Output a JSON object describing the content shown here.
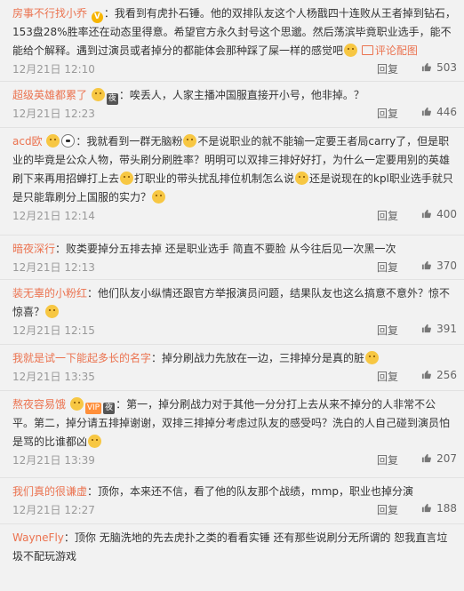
{
  "comments": [
    {
      "user": "房事不行找小乔",
      "badge": "V",
      "text_parts": [
        "：我看到有虎扑石锤。他的双排队友这个人杨戬四十连败从王者掉到钻石，153盘28%胜率还在动态里得意。希望官方永久封号这个思邈。然后荡滨毕竟职业选手，能不能给个解释。遇到过演员或者掉分的都能体会那种踩了屎一样的感觉吧"
      ],
      "pic_link": "评论配图",
      "time": "12月21日 12:10",
      "reply": "回复",
      "likes": "503"
    },
    {
      "user": "超级英雄都累了",
      "text_parts": [
        "：唉丢人，人家主播冲国服直接开小号，他非掉。？"
      ],
      "time": "12月21日 12:23",
      "reply": "回复",
      "likes": "446"
    },
    {
      "user": "acd欧",
      "text_parts": [
        "：我就看到一群无脑粉",
        "不是说职业的就不能输一定要王者局carry了，但是职业的毕竟是公众人物，带头刷分刷胜率？明明可以双排三排好好打，为什么一定要用别的英雄刷下来再用招蝉打上去",
        "打职业的带头扰乱排位机制怎么说",
        "还是说现在的kpl职业选手就只是只能靠刷分上国服的实力？"
      ],
      "time": "12月21日 12:14",
      "reply": "回复",
      "likes": "400"
    },
    {
      "user": "暗夜深行",
      "text_parts": [
        "：败类要掉分五排去掉 还是职业选手 简直不要脸 从今往后见一次黑一次"
      ],
      "time": "12月21日 12:13",
      "reply": "回复",
      "likes": "370"
    },
    {
      "user": "装无辜的小粉红",
      "text_parts": [
        "：他们队友小纵情还跟官方举报演员问题，结果队友也这么搞意不意外？惊不惊喜？"
      ],
      "time": "12月21日 12:15",
      "reply": "回复",
      "likes": "391"
    },
    {
      "user": "我就是试一下能起多长的名字",
      "text_parts": [
        "：掉分刷战力先放在一边，三排掉分是真的脏"
      ],
      "time": "12月21日 13:35",
      "reply": "回复",
      "likes": "256"
    },
    {
      "user": "熬夜容易饿",
      "text_parts": [
        "：第一，掉分刷战力对于其他一分分打上去从来不掉分的人非常不公平。第二，掉分请五排掉谢谢，双排三排掉分考虑过队友的感受吗？洗白的人自己碰到演员怕是骂的比谁都凶"
      ],
      "time": "12月21日 13:39",
      "reply": "回复",
      "likes": "207"
    },
    {
      "user": "我们真的很谦虚",
      "text_parts": [
        "：顶你，本来还不信，看了他的队友那个战绩，mmp，职业也掉分演"
      ],
      "time": "12月21日 12:27",
      "reply": "回复",
      "likes": "188"
    },
    {
      "user": "WayneFly",
      "text_parts": [
        "：顶你 无脑洗地的先去虎扑之类的看看实锤 还有那些说刷分无所谓的 恕我直言垃圾不配玩游戏"
      ]
    }
  ],
  "colors": {
    "username": "#eb7350",
    "background": "#f2f2f2",
    "meta": "#999999"
  }
}
